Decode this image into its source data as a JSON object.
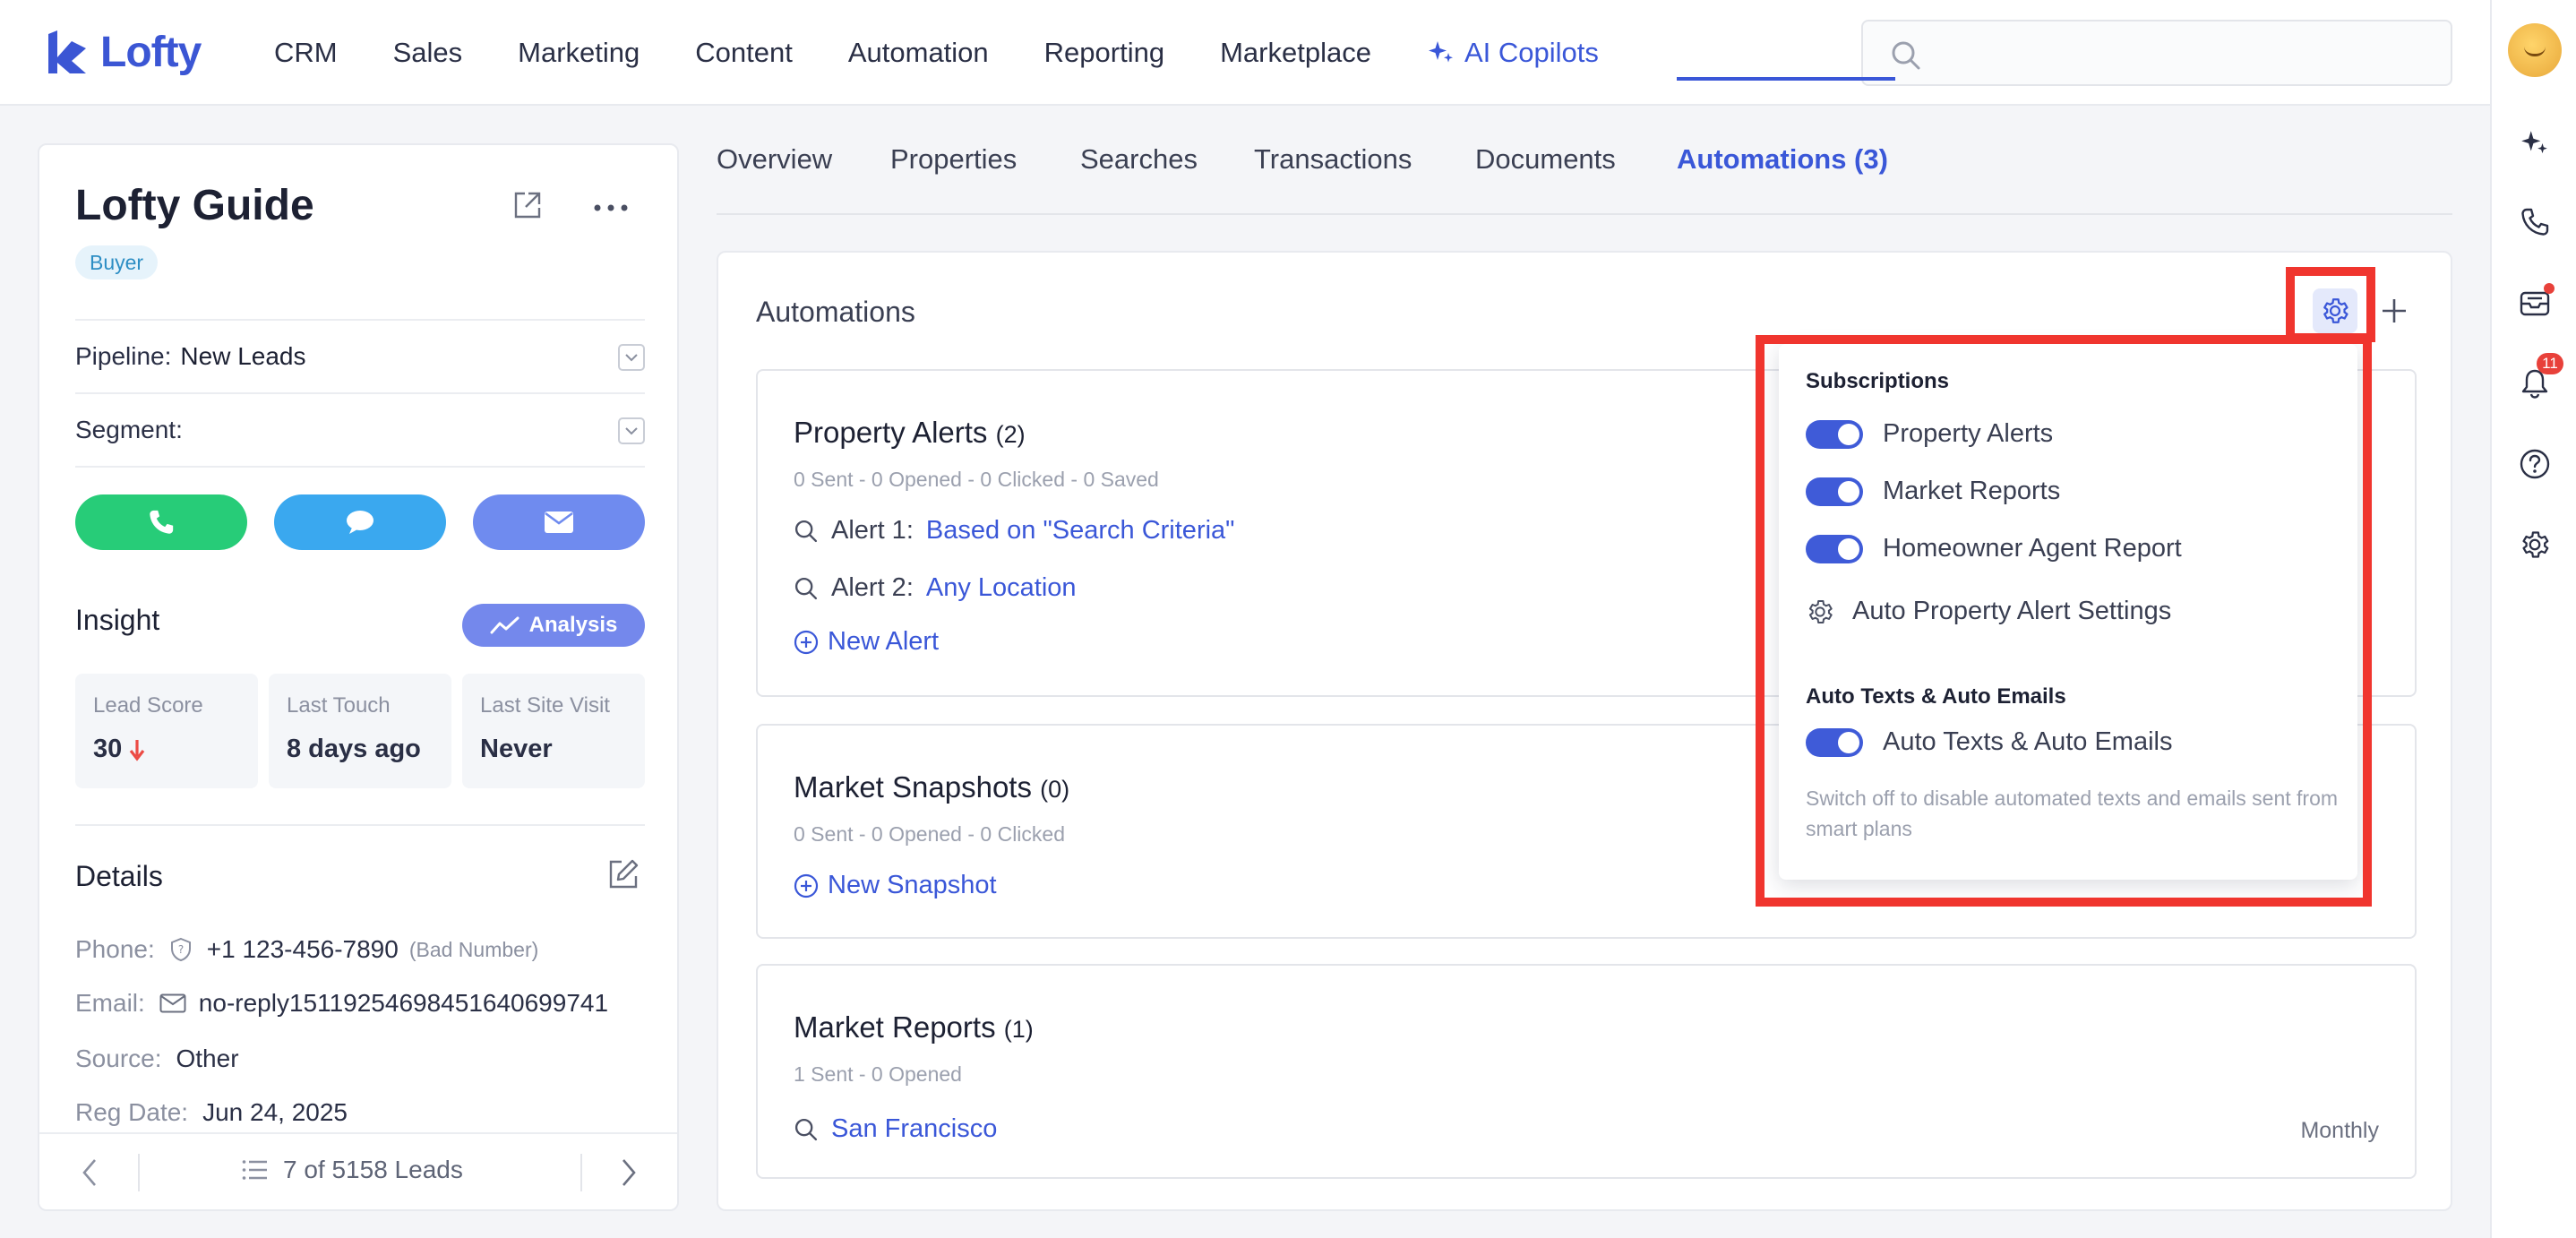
{
  "brand": {
    "name": "Lofty",
    "color": "#3b56d4"
  },
  "nav": {
    "items": [
      "CRM",
      "Sales",
      "Marketing",
      "Content",
      "Automation",
      "Reporting",
      "Marketplace"
    ],
    "ai_label": "AI Copilots"
  },
  "search": {
    "placeholder": ""
  },
  "rail": {
    "notification_count": "11"
  },
  "lead": {
    "name": "Lofty Guide",
    "tag": "Buyer",
    "pipeline_label": "Pipeline:",
    "pipeline_value": "New Leads",
    "segment_label": "Segment:",
    "segment_value": ""
  },
  "insight": {
    "title": "Insight",
    "analysis_label": "Analysis",
    "stats": [
      {
        "label": "Lead Score",
        "value": "30"
      },
      {
        "label": "Last Touch",
        "value": "8 days ago"
      },
      {
        "label": "Last Site Visit",
        "value": "Never"
      }
    ]
  },
  "details": {
    "title": "Details",
    "phone_label": "Phone:",
    "phone_value": "+1 123-456-7890",
    "phone_note": "(Bad Number)",
    "email_label": "Email:",
    "email_value": "no-reply15119254698451640699741",
    "source_label": "Source:",
    "source_value": "Other",
    "reg_label": "Reg Date:",
    "reg_value": "Jun 24, 2025"
  },
  "pager": {
    "text": "7 of 5158 Leads"
  },
  "tabs": [
    "Overview",
    "Properties",
    "Searches",
    "Transactions",
    "Documents",
    "Automations (3)"
  ],
  "automations": {
    "title": "Automations",
    "property_alerts": {
      "title": "Property Alerts",
      "count": "(2)",
      "stats": "0 Sent - 0 Opened - 0 Clicked - 0 Saved",
      "alerts": [
        {
          "label": "Alert 1:",
          "value": "Based on \"Search Criteria\""
        },
        {
          "label": "Alert 2:",
          "value": "Any Location"
        }
      ],
      "new_label": "New Alert"
    },
    "market_snapshots": {
      "title": "Market Snapshots",
      "count": "(0)",
      "stats": "0 Sent - 0 Opened - 0 Clicked",
      "new_label": "New Snapshot"
    },
    "market_reports": {
      "title": "Market Reports",
      "count": "(1)",
      "stats": "1 Sent - 0 Opened",
      "item": "San Francisco",
      "frequency": "Monthly"
    }
  },
  "dropdown": {
    "subscriptions_title": "Subscriptions",
    "toggles": [
      "Property Alerts",
      "Market Reports",
      "Homeowner Agent Report"
    ],
    "settings_label": "Auto Property Alert Settings",
    "auto_title": "Auto Texts & Auto Emails",
    "auto_toggle": "Auto Texts & Auto Emails",
    "auto_help": "Switch off to disable automated texts and emails sent from smart plans"
  },
  "colors": {
    "accent": "#3a57d8",
    "call": "#27cc78",
    "sms": "#3aa8ef",
    "email": "#6f8bef",
    "highlight": "#f0352e"
  }
}
